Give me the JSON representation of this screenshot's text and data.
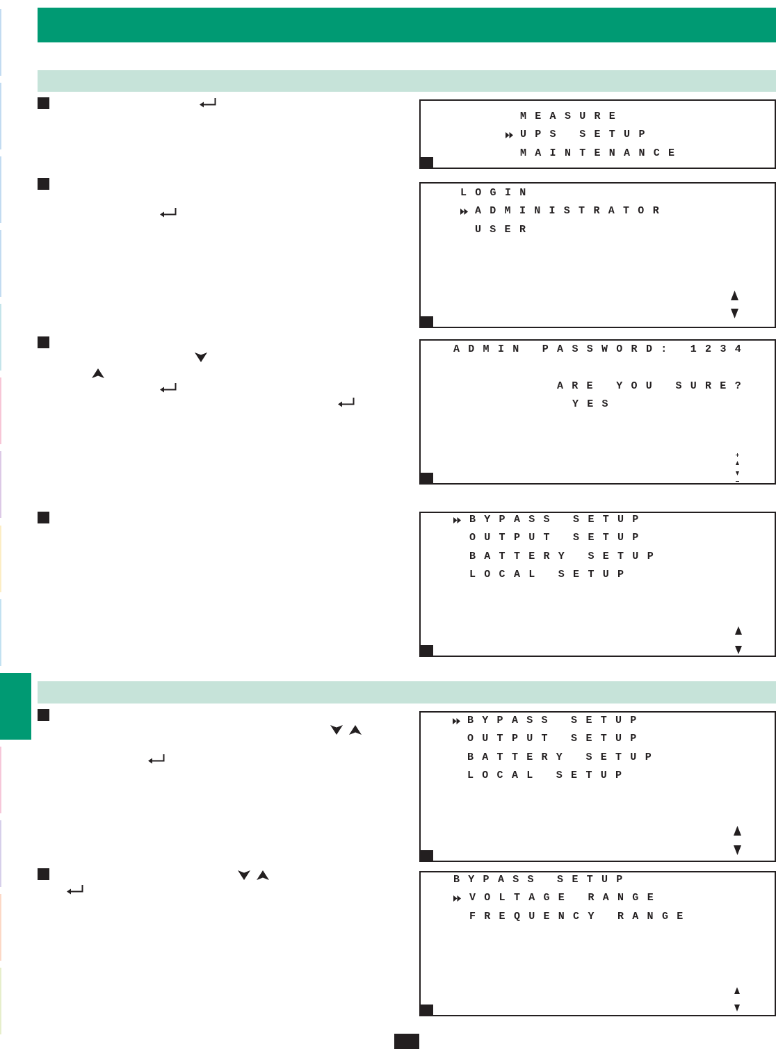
{
  "edge_tabs": [
    {
      "color": "#c2dbf1",
      "selected": false
    },
    {
      "color": "#c2dbf1",
      "selected": false
    },
    {
      "color": "#c2dbf1",
      "selected": false
    },
    {
      "color": "#c2dbf1",
      "selected": false
    },
    {
      "color": "#c4e4ea",
      "selected": false
    },
    {
      "color": "#f7c6d6",
      "selected": false
    },
    {
      "color": "#dcc9e6",
      "selected": false
    },
    {
      "color": "#fcedc4",
      "selected": false
    },
    {
      "color": "#c2e1f1",
      "selected": false
    },
    {
      "color": "#009a73",
      "selected": true
    },
    {
      "color": "#f6c7d9",
      "selected": false
    },
    {
      "color": "#d6cfea",
      "selected": false
    },
    {
      "color": "#fcd8c6",
      "selected": false
    },
    {
      "color": "#e6eecb",
      "selected": false
    }
  ],
  "sections": [
    {
      "steps": [
        {
          "keys": [
            {
              "kind": "enter"
            }
          ],
          "screen": {
            "lines": [
              {
                "kind": "option",
                "text": "MEASURE",
                "selected": false
              },
              {
                "kind": "option",
                "text": "UPS SETUP",
                "selected": true
              },
              {
                "kind": "option",
                "text": "MAINTENANCE",
                "selected": false
              }
            ]
          }
        },
        {
          "keys": [
            {
              "kind": "enter"
            }
          ],
          "screen": {
            "lines": [
              {
                "kind": "title",
                "text": "LOGIN"
              },
              {
                "kind": "option",
                "text": "ADMINISTRATOR",
                "selected": true
              },
              {
                "kind": "option",
                "text": "USER",
                "selected": false
              }
            ],
            "indicator": {
              "kind": "arrows"
            }
          }
        },
        {
          "keys": [
            {
              "kind": "down"
            },
            {
              "kind": "up"
            },
            {
              "kind": "enter"
            },
            {
              "kind": "enter"
            }
          ],
          "screen": {
            "lines": [
              {
                "kind": "title",
                "text": "ADMIN PASSWORD: 1234"
              },
              {
                "kind": "prompt",
                "text": "ARE YOU SURE?"
              },
              {
                "kind": "value",
                "text": "YES"
              }
            ],
            "indicator": {
              "kind": "adjust"
            }
          }
        },
        {
          "screen": {
            "lines": [
              {
                "kind": "option",
                "text": "BYPASS SETUP",
                "selected": true
              },
              {
                "kind": "option",
                "text": "OUTPUT SETUP",
                "selected": false
              },
              {
                "kind": "option",
                "text": "BATTERY SETUP",
                "selected": false
              },
              {
                "kind": "option",
                "text": "LOCAL SETUP",
                "selected": false
              }
            ],
            "indicator": {
              "kind": "arrows"
            }
          }
        }
      ]
    },
    {
      "steps": [
        {
          "keys": [
            {
              "kind": "down"
            },
            {
              "kind": "up"
            },
            {
              "kind": "enter"
            }
          ],
          "screen": {
            "lines": [
              {
                "kind": "option",
                "text": "BYPASS SETUP",
                "selected": true
              },
              {
                "kind": "option",
                "text": "OUTPUT SETUP",
                "selected": false
              },
              {
                "kind": "option",
                "text": "BATTERY SETUP",
                "selected": false
              },
              {
                "kind": "option",
                "text": "LOCAL SETUP",
                "selected": false
              }
            ],
            "indicator": {
              "kind": "arrows"
            }
          }
        },
        {
          "keys": [
            {
              "kind": "down"
            },
            {
              "kind": "up"
            },
            {
              "kind": "enter"
            }
          ],
          "screen": {
            "lines": [
              {
                "kind": "title",
                "text": "BYPASS SETUP"
              },
              {
                "kind": "option",
                "text": "VOLTAGE RANGE",
                "selected": true
              },
              {
                "kind": "option",
                "text": "FREQUENCY RANGE",
                "selected": false
              }
            ],
            "indicator": {
              "kind": "arrows"
            }
          }
        }
      ]
    }
  ]
}
